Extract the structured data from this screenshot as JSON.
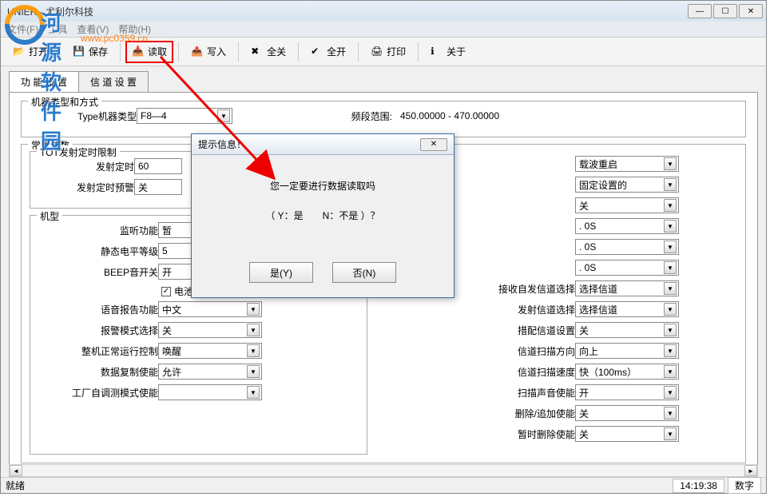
{
  "window": {
    "title": "UNIER - 尤利尔科技"
  },
  "menubar": {
    "file": "文件(F)",
    "tool": "工具",
    "view": "查看(V)",
    "help": "帮助(H)"
  },
  "toolbar": {
    "open": "打开",
    "save": "保存",
    "read": "读取",
    "write": "写入",
    "all_close": "全关",
    "all_open": "全开",
    "print": "打印",
    "about": "关于"
  },
  "tabs": {
    "tab1": "功 能 设 置",
    "tab2": "信 道 设 置"
  },
  "groups": {
    "g1": "机器类型和方式",
    "g2": "常用参数",
    "g3": "TOT发射定时限制",
    "g4": "机型"
  },
  "fields": {
    "type_label": "Type机器类型",
    "type_value": "F8—4",
    "freq_range_label": "频段范围:",
    "freq_range_value": "450.00000 - 470.00000",
    "tx_timer_label": "发射定时",
    "tx_timer_value": "60",
    "tx_prealarm_label": "发射定时预警",
    "tx_prealarm_value": "关",
    "monitor_label": "监听功能",
    "monitor_value": "暂",
    "squelch_label": "静态电平等级",
    "squelch_value": "5",
    "beep_label": "BEEP音开关",
    "beep_value": "开",
    "batt_save_chk": "电池省电使能",
    "voice_label": "语音报告功能",
    "voice_value": "中文",
    "alarm_label": "报警模式选择",
    "alarm_value": "关",
    "normal_label": "整机正常运行控制",
    "normal_value": "唤醒",
    "copy_label": "数据复制使能",
    "copy_value": "允许",
    "factory_label": "工厂自调测模式使能",
    "factory_value": "",
    "r1_label": "",
    "r1_value": "载波重启",
    "r2_value": "固定设置的",
    "r3_value": "关",
    "r4_value": ". 0S",
    "r5_value": ". 0S",
    "r6_value": ". 0S",
    "r7_label": "接收自发信道选择",
    "r7_value": "选择信道",
    "r8_label": "发射信道选择",
    "r8_value": "选择信道",
    "r9_label": "措配信道设置",
    "r9_value": "关",
    "r10_label": "信道扫描方向",
    "r10_value": "向上",
    "r11_label": "信道扫描速度",
    "r11_value": "快（100ms）",
    "r12_label": "扫描声音使能",
    "r12_value": "开",
    "r13_label": "删除/追加使能",
    "r13_value": "关",
    "r14_label": "暂时删除使能",
    "r14_value": "关"
  },
  "dialog": {
    "title": "提示信息！",
    "line1": "您一定要进行数据读取吗",
    "line2": "（ Y：是　　N：不是 ）？",
    "yes": "是(Y)",
    "no": "否(N)"
  },
  "status": {
    "ready": "就绪",
    "time": "14:19:38",
    "num": "数字"
  },
  "watermark": {
    "text": "河源软件园",
    "url": "www.pc0359.cn"
  }
}
